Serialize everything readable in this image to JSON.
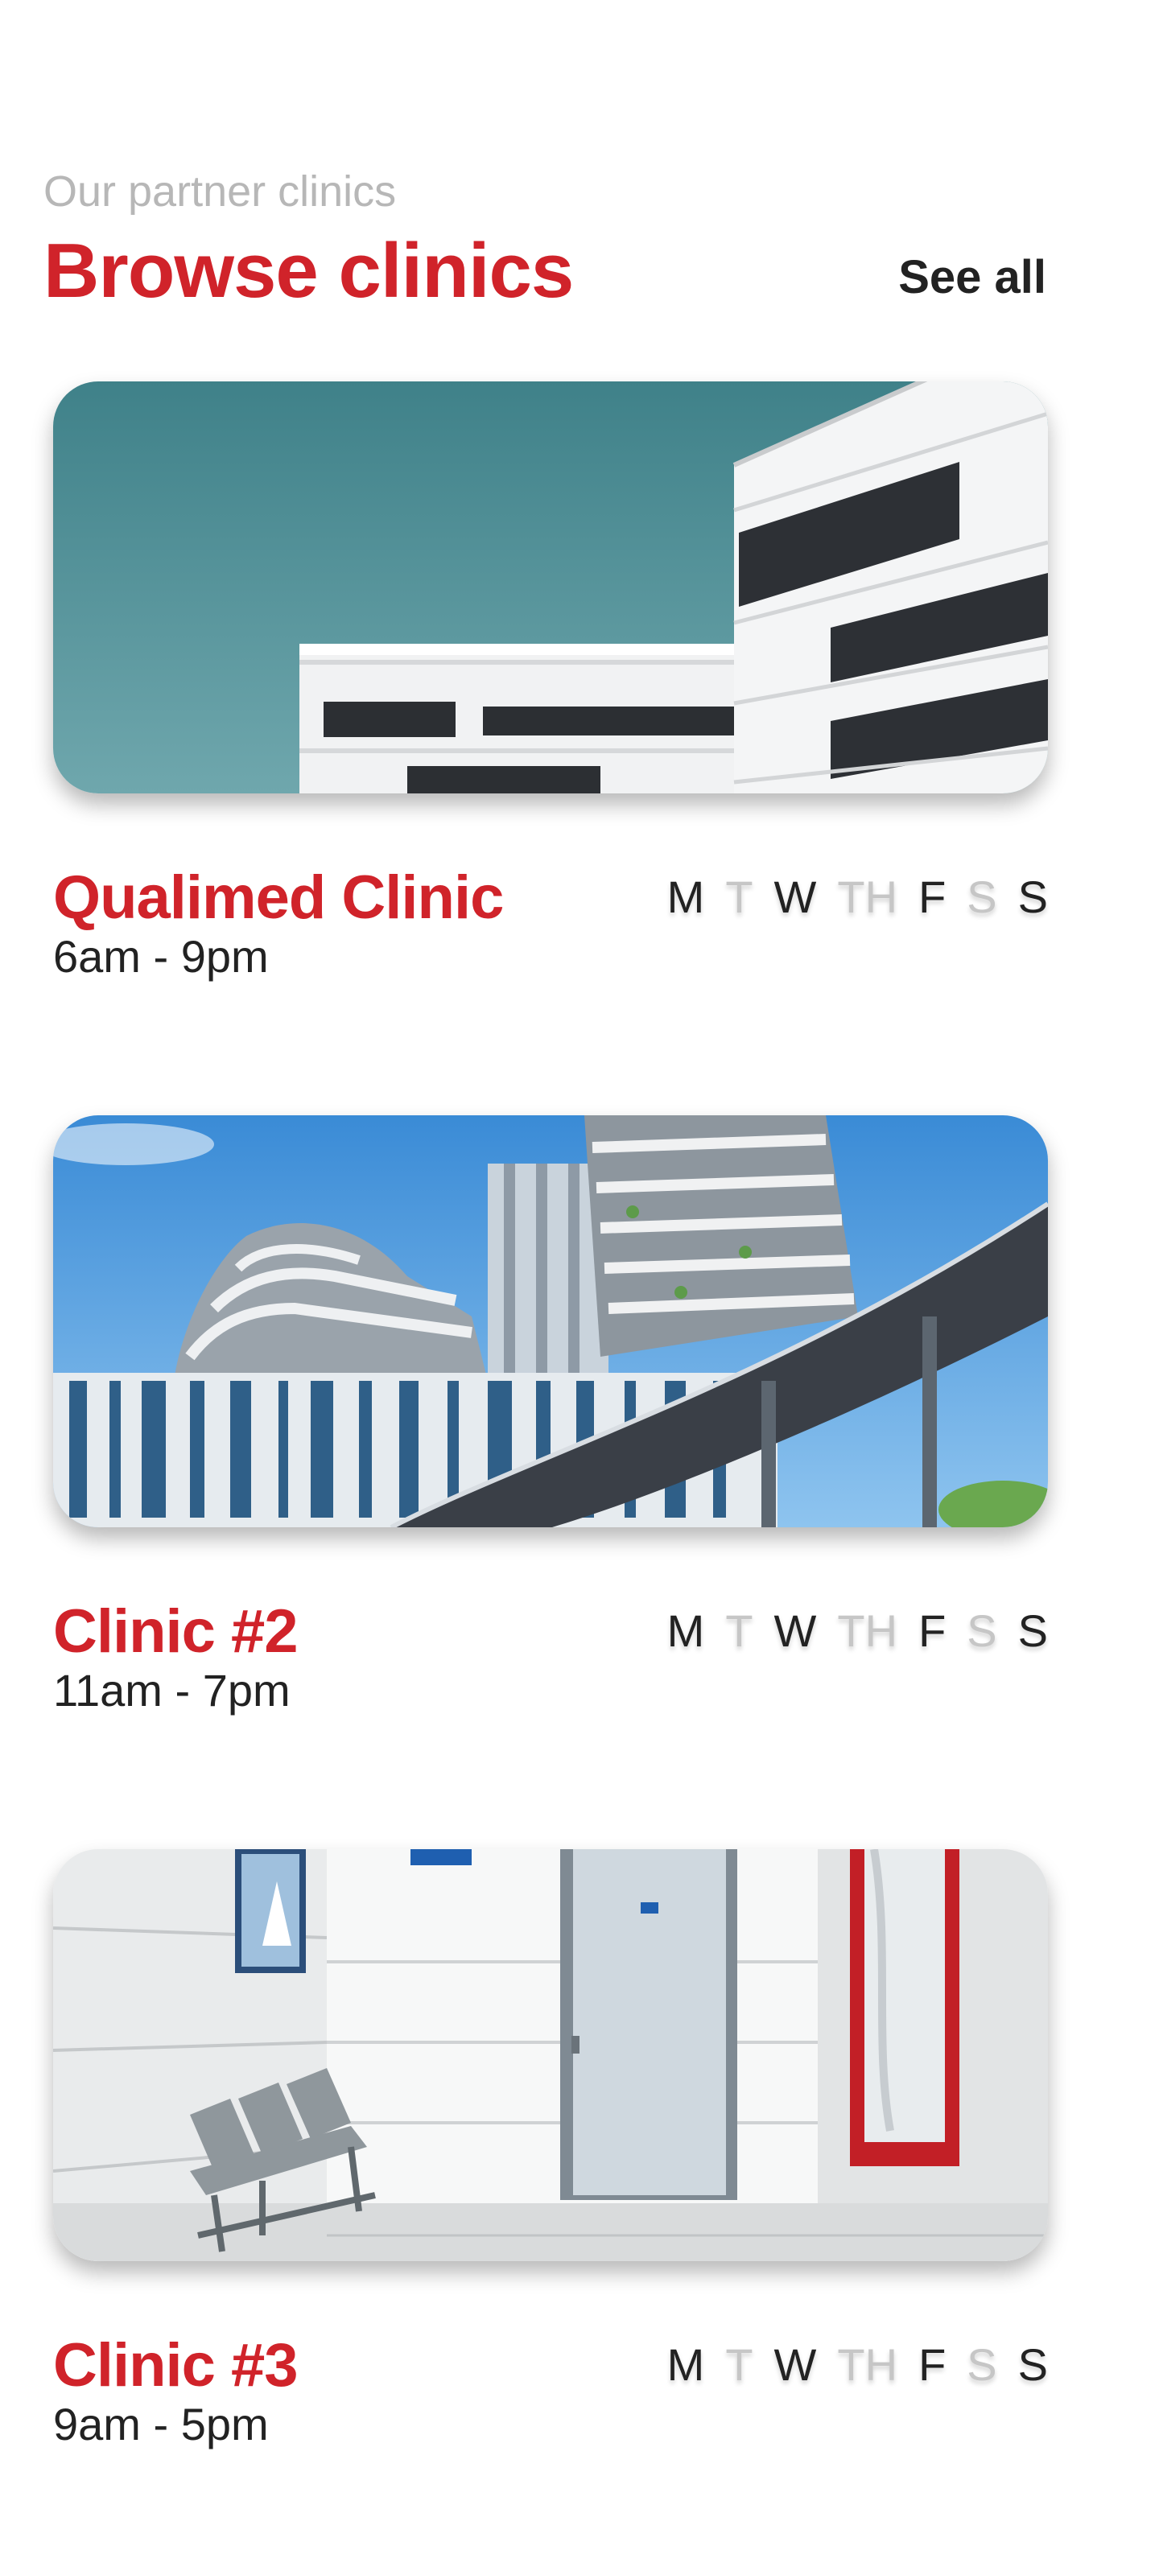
{
  "header": {
    "eyebrow": "Our partner clinics",
    "title": "Browse clinics",
    "see_all": "See all"
  },
  "colors": {
    "accent": "#d0232a",
    "text": "#222222",
    "muted": "#b7b7b7",
    "day_closed": "#c6c6c6"
  },
  "clinics": [
    {
      "name": "Qualimed Clinic",
      "hours": "6am - 9pm",
      "image_icon": "modern-building-photo",
      "days": [
        {
          "label": "M",
          "open": true
        },
        {
          "label": "T",
          "open": false
        },
        {
          "label": "W",
          "open": true
        },
        {
          "label": "TH",
          "open": false
        },
        {
          "label": "F",
          "open": true
        },
        {
          "label": "S",
          "open": false
        },
        {
          "label": "S",
          "open": true
        }
      ]
    },
    {
      "name": "Clinic #2",
      "hours": "11am - 7pm",
      "image_icon": "curved-towers-photo",
      "days": [
        {
          "label": "M",
          "open": true
        },
        {
          "label": "T",
          "open": false
        },
        {
          "label": "W",
          "open": true
        },
        {
          "label": "TH",
          "open": false
        },
        {
          "label": "F",
          "open": true
        },
        {
          "label": "S",
          "open": false
        },
        {
          "label": "S",
          "open": true
        }
      ]
    },
    {
      "name": "Clinic #3",
      "hours": "9am - 5pm",
      "image_icon": "waiting-room-photo",
      "days": [
        {
          "label": "M",
          "open": true
        },
        {
          "label": "T",
          "open": false
        },
        {
          "label": "W",
          "open": true
        },
        {
          "label": "TH",
          "open": false
        },
        {
          "label": "F",
          "open": true
        },
        {
          "label": "S",
          "open": false
        },
        {
          "label": "S",
          "open": true
        }
      ]
    }
  ]
}
